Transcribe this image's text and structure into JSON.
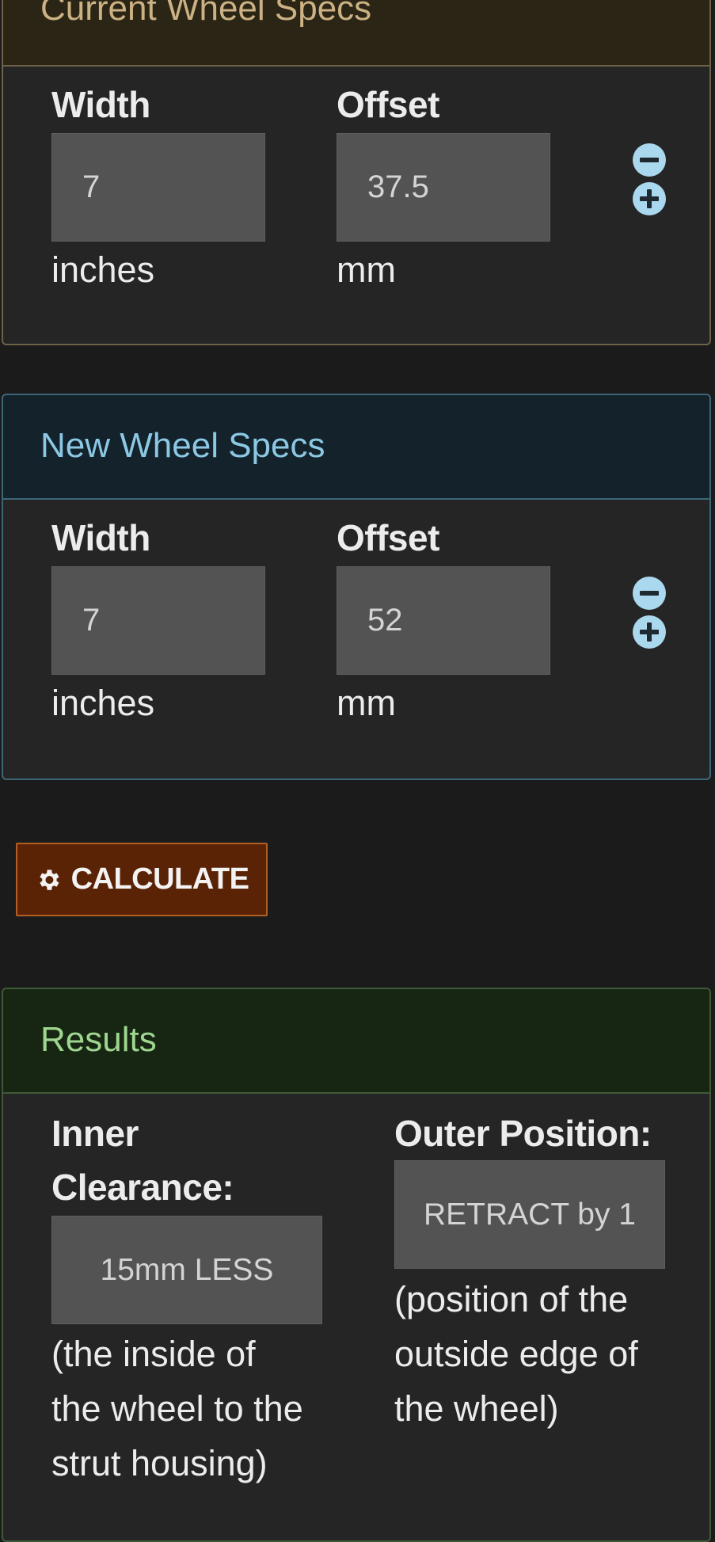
{
  "current": {
    "title": "Current Wheel Specs",
    "width_label": "Width",
    "width_value": "7",
    "width_unit": "inches",
    "offset_label": "Offset",
    "offset_value": "37.5",
    "offset_unit": "mm"
  },
  "new": {
    "title": "New Wheel Specs",
    "width_label": "Width",
    "width_value": "7",
    "width_unit": "inches",
    "offset_label": "Offset",
    "offset_value": "52",
    "offset_unit": "mm"
  },
  "calculate": {
    "label": "CALCULATE",
    "icon": "gear-icon"
  },
  "results": {
    "title": "Results",
    "inner_label_line1": "Inner",
    "inner_label_line2": "Clearance:",
    "inner_value": "15mm LESS",
    "inner_note_line1": "(the inside of",
    "inner_note_line2": "the wheel to the",
    "inner_note_line3": "strut housing)",
    "outer_label": "Outer Position:",
    "outer_value": "RETRACT by 1",
    "outer_note_line1": "(position of the",
    "outer_note_line2": "outside edge of",
    "outer_note_line3": "the wheel)"
  },
  "colors": {
    "current_accent": "#cbb183",
    "new_accent": "#8cc8e4",
    "results_accent": "#9ed58f",
    "button_bg": "#5b2305",
    "stepper_icon": "#a9d8ef"
  }
}
